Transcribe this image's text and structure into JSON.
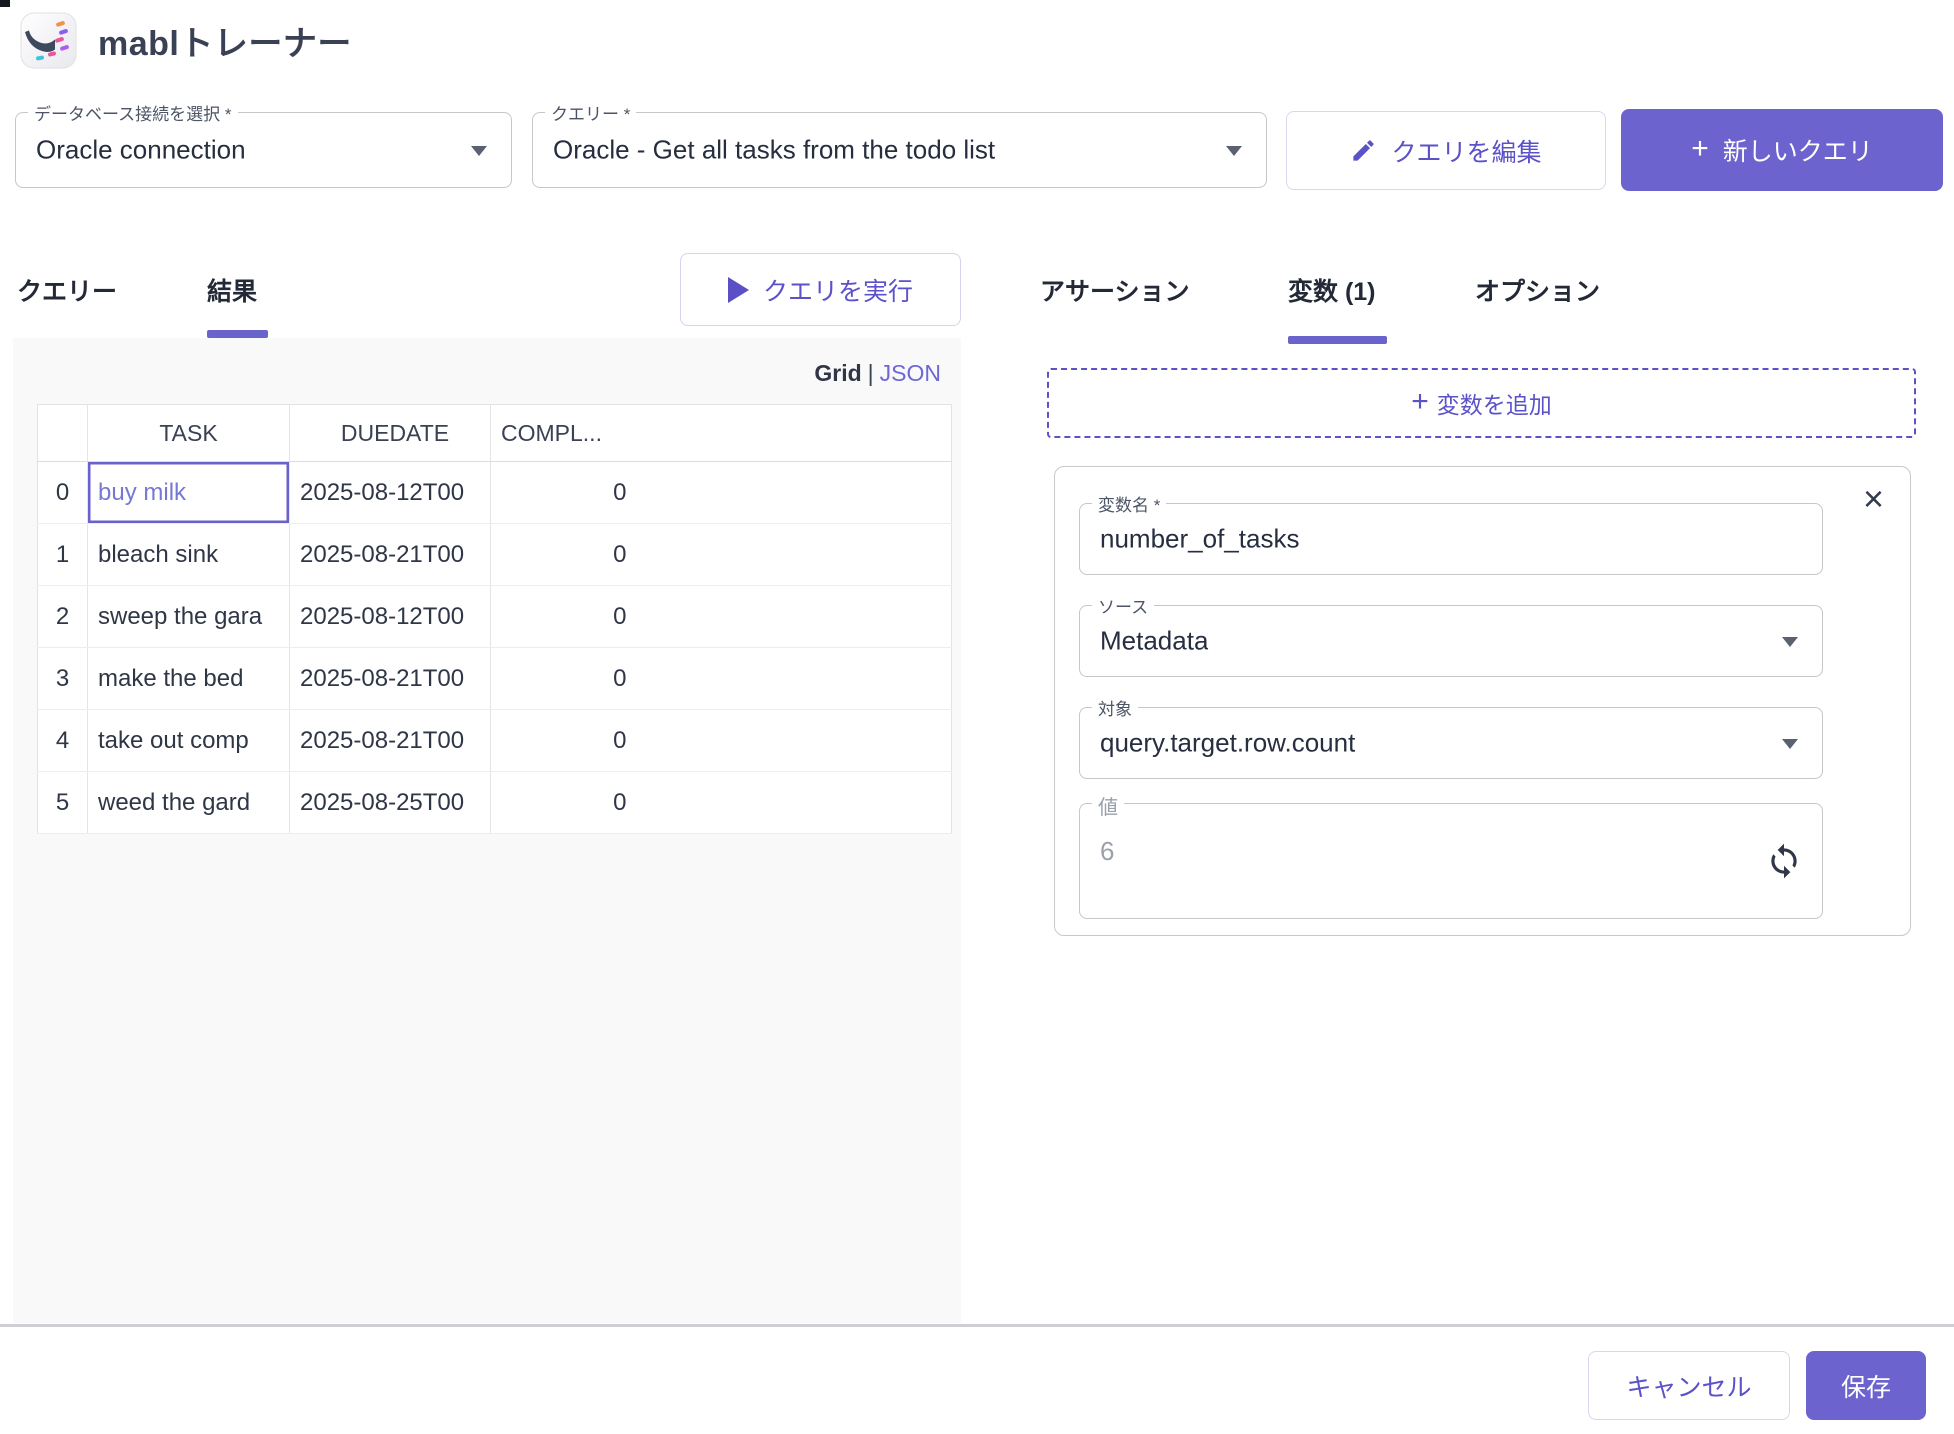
{
  "colors": {
    "accent_text": "#5b51c8",
    "accent_fill": "#6c63ce",
    "selected_cell": "#6a62cb",
    "link": "#6e67d6"
  },
  "header": {
    "app_title": "mablトレーナー"
  },
  "toolbar": {
    "connection": {
      "label": "データベース接続を選択 *",
      "value": "Oracle connection"
    },
    "query": {
      "label": "クエリー *",
      "value": "Oracle - Get all tasks from the todo list"
    },
    "edit_query_label": "クエリを編集",
    "new_query_label": "新しいクエリ",
    "plus_glyph": "+"
  },
  "results_panel": {
    "tabs": [
      {
        "label": "クエリー"
      },
      {
        "label": "結果"
      }
    ],
    "active_tab": "結果",
    "run_query_label": "クエリを実行",
    "view_toggle": {
      "grid": "Grid",
      "divider": "|",
      "json": "JSON"
    },
    "table": {
      "columns": [
        "",
        "TASK",
        "DUEDATE",
        "COMPL..."
      ],
      "rows": [
        {
          "index": "0",
          "task": "buy milk",
          "duedate": "2025-08-12T00",
          "completed": "0",
          "selected": true
        },
        {
          "index": "1",
          "task": "bleach sink",
          "duedate": "2025-08-21T00",
          "completed": "0",
          "selected": false
        },
        {
          "index": "2",
          "task": "sweep the gara",
          "duedate": "2025-08-12T00",
          "completed": "0",
          "selected": false
        },
        {
          "index": "3",
          "task": "make the bed",
          "duedate": "2025-08-21T00",
          "completed": "0",
          "selected": false
        },
        {
          "index": "4",
          "task": "take out comp",
          "duedate": "2025-08-21T00",
          "completed": "0",
          "selected": false
        },
        {
          "index": "5",
          "task": "weed the gard",
          "duedate": "2025-08-25T00",
          "completed": "0",
          "selected": false
        }
      ]
    }
  },
  "detail_panel": {
    "tabs": [
      {
        "label": "アサーション"
      },
      {
        "label": "変数 (1)"
      },
      {
        "label": "オプション"
      }
    ],
    "active_tab": "変数 (1)",
    "add_variable_label": "変数を追加",
    "plus_glyph": "+",
    "variable_card": {
      "close_glyph": "×",
      "name": {
        "label": "変数名 *",
        "value": "number_of_tasks"
      },
      "source": {
        "label": "ソース",
        "value": "Metadata"
      },
      "target": {
        "label": "対象",
        "value": "query.target.row.count"
      },
      "value": {
        "label": "値",
        "value": "6"
      }
    }
  },
  "footer": {
    "cancel_label": "キャンセル",
    "save_label": "保存"
  }
}
